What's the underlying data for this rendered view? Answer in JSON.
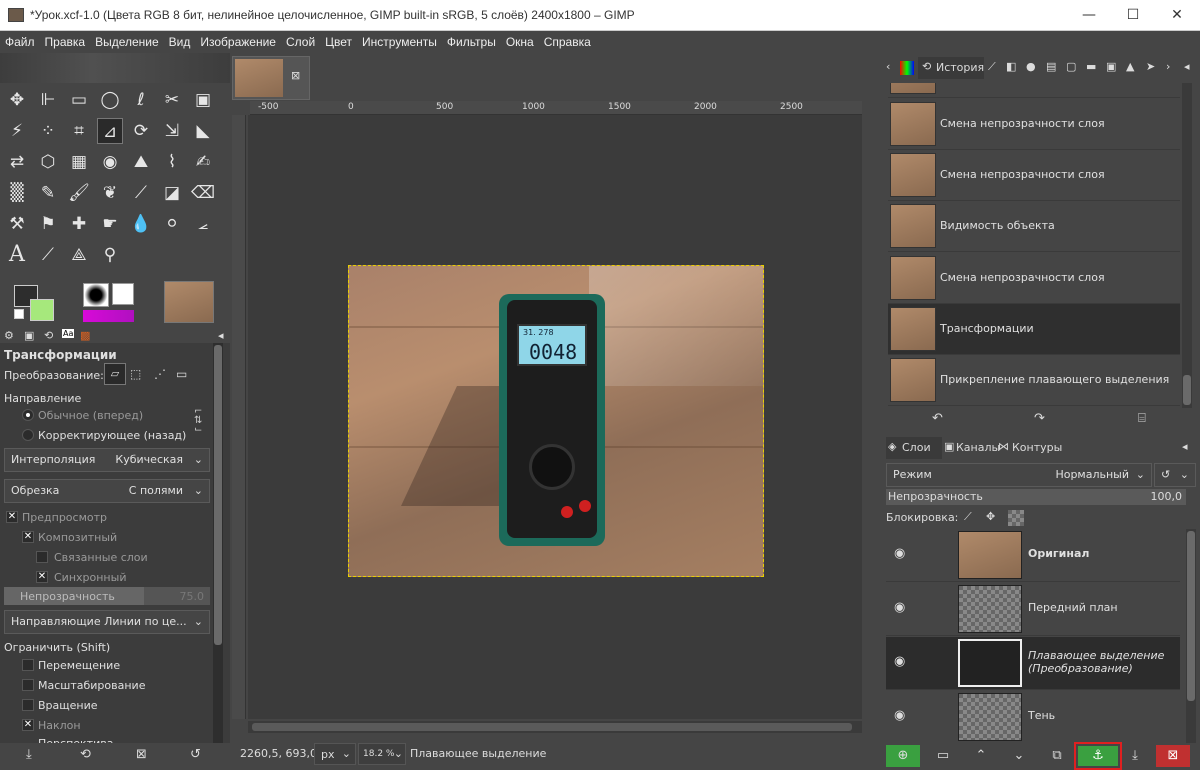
{
  "window": {
    "title": "*Урок.xcf-1.0 (Цвета RGB 8 бит, нелинейное целочисленное, GIMP built-in sRGB, 5 слоёв) 2400x1800 – GIMP"
  },
  "menu": [
    "Файл",
    "Правка",
    "Выделение",
    "Вид",
    "Изображение",
    "Слой",
    "Цвет",
    "Инструменты",
    "Фильтры",
    "Окна",
    "Справка"
  ],
  "tool_options": {
    "title": "Трансформации",
    "transform_label": "Преобразование:",
    "direction_label": "Направление",
    "dir_normal": "Обычное (вперед)",
    "dir_corrective": "Корректирующее (назад)",
    "interp_label": "Интерполяция",
    "interp_value": "Кубическая",
    "clip_label": "Обрезка",
    "clip_value": "С полями",
    "preview": "Предпросмотр",
    "composite": "Композитный",
    "linked": "Связанные слои",
    "sync": "Синхронный",
    "opacity_label": "Непрозрачность",
    "opacity_value": "75.0",
    "guides": "Направляющие Линии по це...",
    "constrain": "Ограничить (Shift)",
    "c_move": "Перемещение",
    "c_scale": "Масштабирование",
    "c_rotate": "Вращение",
    "c_shear": "Наклон",
    "c_persp": "Перспектива"
  },
  "ruler": [
    "-500",
    "0",
    "500",
    "1000",
    "1500",
    "2000",
    "2500"
  ],
  "status": {
    "coords": "2260,5, 693,0",
    "unit": "px",
    "zoom": "18.2 %",
    "message": "Плавающее выделение"
  },
  "meter": {
    "top": "31.  278",
    "main": "0048"
  },
  "history": {
    "tab": "История",
    "items": [
      "Смена непрозрачности слоя",
      "Смена непрозрачности слоя",
      "Видимость объекта",
      "Смена непрозрачности слоя",
      "Трансформации",
      "Прикрепление плавающего выделения"
    ]
  },
  "layers": {
    "tabs": [
      "Слои",
      "Каналы",
      "Контуры"
    ],
    "mode_label": "Режим",
    "mode_value": "Нормальный",
    "opacity_label": "Непрозрачность",
    "opacity_value": "100,0",
    "lock_label": "Блокировка:",
    "items": [
      "Оригинал",
      "Передний план",
      "Плавающее выделение (Преобразование)",
      "Тень"
    ]
  },
  "colors": {
    "fg": "#2d2d2d",
    "bg": "#a6e87c",
    "gradient_from": "#d80ad8",
    "highlight": "#e02020",
    "anchor_green": "#3aa040",
    "delete_red": "#c03030"
  }
}
